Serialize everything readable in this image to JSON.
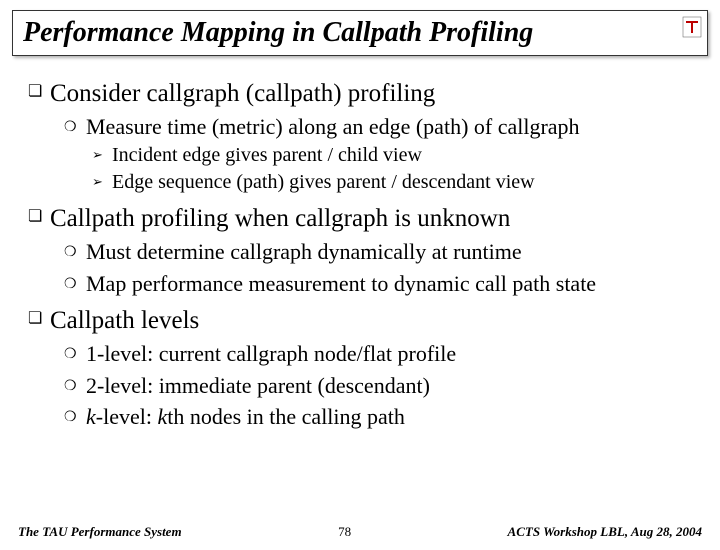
{
  "title": "Performance Mapping in Callpath Profiling",
  "logo": {
    "label": "tau-logo"
  },
  "body": {
    "s1": {
      "heading": "Consider callgraph (callpath) profiling",
      "i1": "Measure time (metric) along an edge (path) of callgraph",
      "i1a": "Incident edge gives parent / child view",
      "i1b": "Edge sequence (path) gives parent / descendant view"
    },
    "s2": {
      "heading": "Callpath profiling when callgraph is unknown",
      "i1": "Must determine callgraph dynamically at runtime",
      "i2": "Map performance measurement to dynamic call path state"
    },
    "s3": {
      "heading": "Callpath levels",
      "i1": "1-level: current callgraph node/flat profile",
      "i2": "2-level: immediate parent (descendant)",
      "i3_pre": "k",
      "i3_mid": "-level: ",
      "i3_k2": "k",
      "i3_post": "th nodes in the calling path"
    }
  },
  "footer": {
    "left": "The TAU Performance System",
    "center": "78",
    "right": "ACTS Workshop LBL, Aug 28, 2004"
  }
}
